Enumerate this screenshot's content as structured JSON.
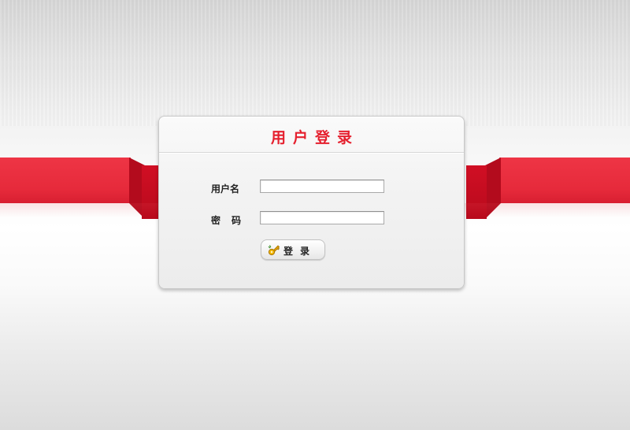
{
  "login": {
    "title": "用户登录",
    "username_label": "用户名",
    "username_value": "",
    "password_label": "密码",
    "password_value": "",
    "button_label": "登录",
    "button_icon": "key-icon"
  },
  "colors": {
    "title": "#e5202e",
    "ribbon": "#e62a3b",
    "ribbon_dark": "#c20d20"
  }
}
